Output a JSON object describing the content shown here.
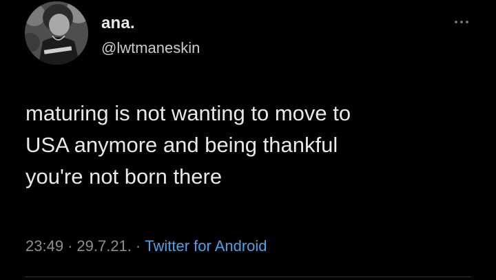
{
  "tweet": {
    "display_name": "ana.",
    "handle": "@lwtmaneskin",
    "text": "maturing is not wanting to move to\nUSA anymore and being thankful\nyou're not born there",
    "time": "23:49",
    "separator": "·",
    "date": "29.7.21.",
    "source": "Twitter for Android"
  },
  "icons": {
    "avatar": "profile-photo",
    "more": "more-dots-icon"
  },
  "colors": {
    "background": "#000000",
    "text": "#e7e9ea",
    "muted": "#8b9096",
    "link": "#4aa3e8"
  }
}
